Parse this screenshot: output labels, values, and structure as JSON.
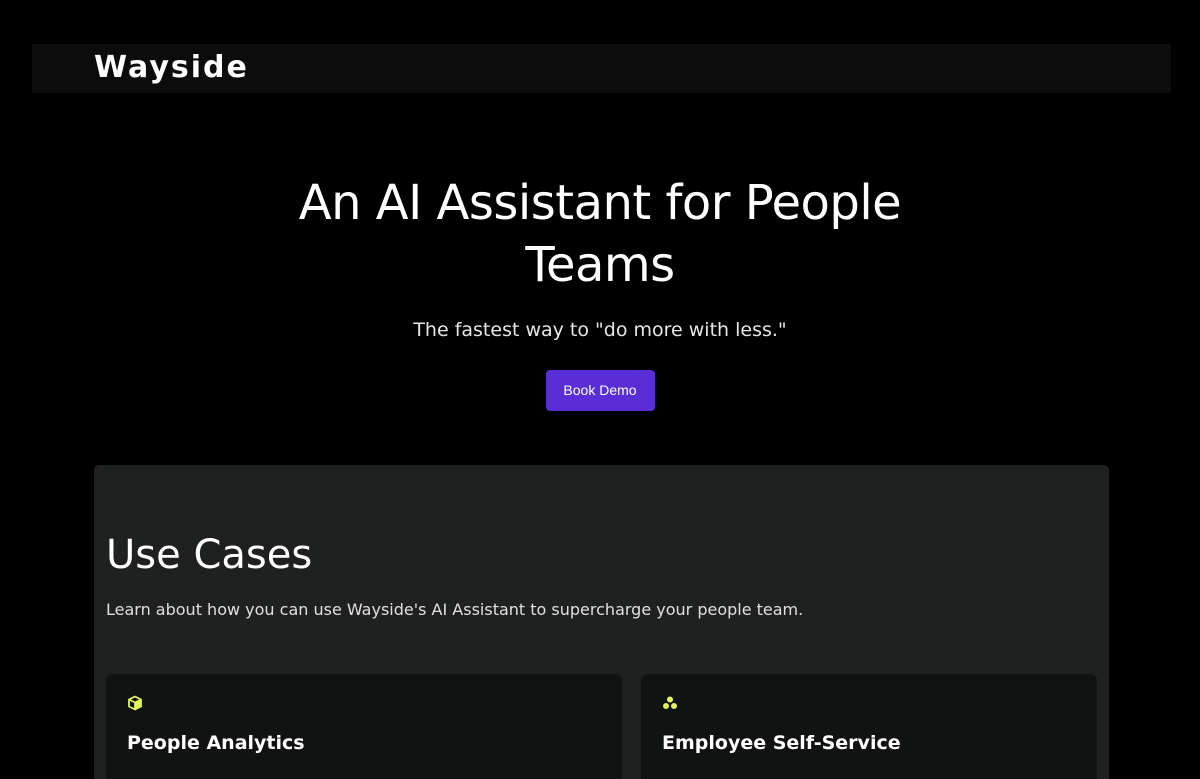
{
  "header": {
    "logo_text": "Wayside"
  },
  "hero": {
    "title": "An AI Assistant for People Teams",
    "subtitle": "The fastest way to \"do more with less.\"",
    "cta_label": "Book Demo"
  },
  "use_cases": {
    "title": "Use Cases",
    "description": "Learn about how you can use Wayside's AI Assistant to supercharge your people team.",
    "cards": [
      {
        "icon": "cube-icon",
        "title": "People Analytics"
      },
      {
        "icon": "three-dots-icon",
        "title": "Employee Self-Service"
      }
    ]
  },
  "colors": {
    "background": "#000000",
    "navbar": "#0c0c0c",
    "accent_button": "#5a2ed6",
    "section_bg": "#1f2020",
    "card_bg": "#111212",
    "icon_accent": "#e4f75a"
  }
}
